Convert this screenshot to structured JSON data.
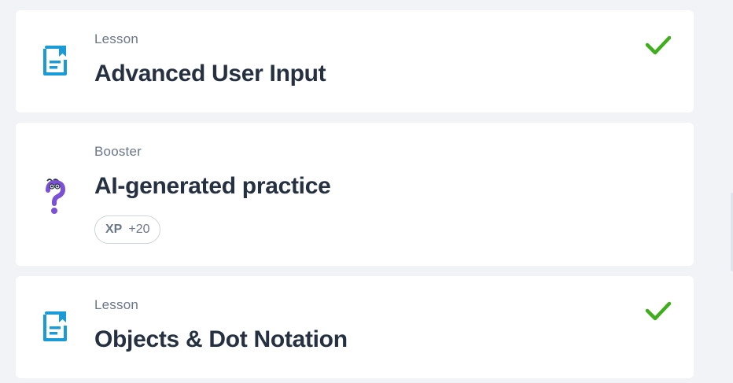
{
  "items": [
    {
      "type": "Lesson",
      "title": "Advanced User Input",
      "icon": "lesson-document-icon",
      "completed": true
    },
    {
      "type": "Booster",
      "title": "AI-generated practice",
      "icon": "question-mark-character-icon",
      "completed": false,
      "xp": {
        "label": "XP",
        "value": "+20"
      }
    },
    {
      "type": "Lesson",
      "title": "Objects & Dot Notation",
      "icon": "lesson-document-icon",
      "completed": true
    }
  ],
  "colors": {
    "lesson_icon": "#1a9bd8",
    "booster_icon": "#7b4fd6",
    "check": "#3fae1c",
    "title": "#253041",
    "subtext": "#6b7689"
  }
}
